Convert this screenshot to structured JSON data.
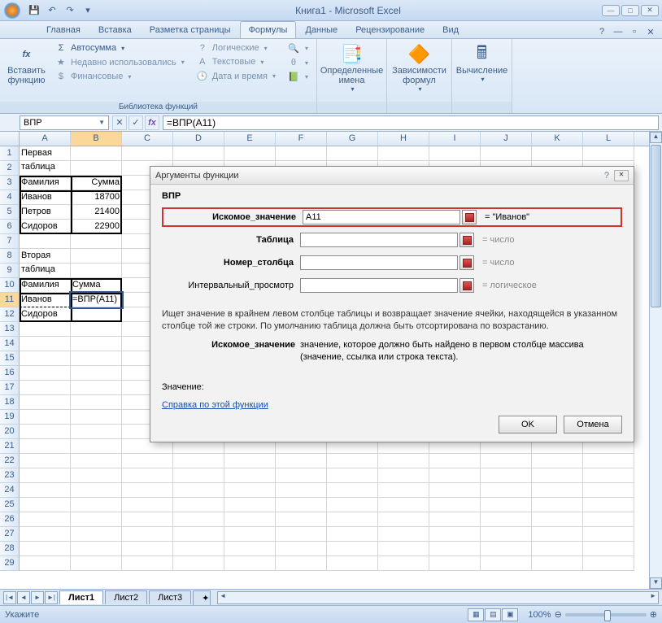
{
  "title": "Книга1 - Microsoft Excel",
  "tabs": [
    "Главная",
    "Вставка",
    "Разметка страницы",
    "Формулы",
    "Данные",
    "Рецензирование",
    "Вид"
  ],
  "active_tab": 3,
  "ribbon": {
    "insert_fn": "Вставить\nфункцию",
    "lib": {
      "autosum": "Автосумма",
      "recent": "Недавно использовались",
      "financial": "Финансовые",
      "logical": "Логические",
      "text": "Текстовые",
      "datetime": "Дата и время",
      "title": "Библиотека функций"
    },
    "names": "Определенные\nимена",
    "audit": "Зависимости\nформул",
    "calc": "Вычисление"
  },
  "namebox": "ВПР",
  "formula": "=ВПР(A11)",
  "columns": [
    "A",
    "B",
    "C",
    "D",
    "E",
    "F",
    "G",
    "H",
    "I",
    "J",
    "K",
    "L"
  ],
  "rows_count": 29,
  "cells": {
    "A1": "Первая таблица",
    "A3": "Фамилия",
    "B3": "Сумма",
    "A4": "Иванов",
    "B4": "18700",
    "A5": "Петров",
    "B5": "21400",
    "A6": "Сидоров",
    "B6": "22900",
    "A8": "Вторая таблица",
    "A10": "Фамилия",
    "B10": "Сумма",
    "A11": "Иванов",
    "B11": "=ВПР(A11)",
    "A12": "Сидоров"
  },
  "dialog": {
    "title": "Аргументы функции",
    "fn": "ВПР",
    "args": [
      {
        "label": "Искомое_значение",
        "value": "A11",
        "result": "= \"Иванов\"",
        "bold": true
      },
      {
        "label": "Таблица",
        "value": "",
        "result": "= число",
        "bold": true,
        "gray": true
      },
      {
        "label": "Номер_столбца",
        "value": "",
        "result": "= число",
        "bold": true,
        "gray": true
      },
      {
        "label": "Интервальный_просмотр",
        "value": "",
        "result": "= логическое",
        "bold": false,
        "gray": true
      }
    ],
    "desc": "Ищет значение в крайнем левом столбце таблицы и возвращает значение ячейки, находящейся в указанном столбце той же строки. По умолчанию таблица должна быть отсортирована по возрастанию.",
    "argdesc_label": "Искомое_значение",
    "argdesc": "значение, которое должно быть найдено в первом столбце массива (значение, ссылка или строка текста).",
    "value_label": "Значение:",
    "help": "Справка по этой функции",
    "ok": "OK",
    "cancel": "Отмена"
  },
  "sheets": [
    "Лист1",
    "Лист2",
    "Лист3"
  ],
  "active_sheet": 0,
  "status": "Укажите",
  "zoom": "100%"
}
